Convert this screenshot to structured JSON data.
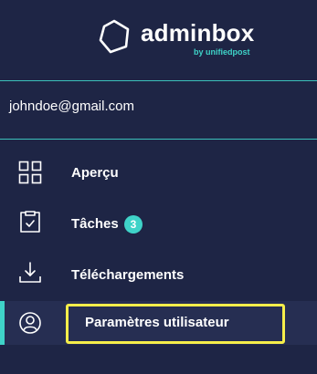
{
  "brand": {
    "name": "adminbox",
    "sub": "by unifiedpost",
    "accent_color": "#3fd3c8",
    "icon": "hexagon-logo-icon"
  },
  "user": {
    "email": "johndoe@gmail.com"
  },
  "nav": {
    "items": [
      {
        "label": "Aperçu",
        "icon": "grid-icon"
      },
      {
        "label": "Tâches",
        "icon": "clipboard-check-icon",
        "badge": "3"
      },
      {
        "label": "Téléchargements",
        "icon": "download-icon"
      },
      {
        "label": "Paramètres utilisateur",
        "icon": "user-circle-icon",
        "active": true
      }
    ]
  },
  "colors": {
    "background": "#1e2545",
    "highlight": "#f6ee4a"
  }
}
